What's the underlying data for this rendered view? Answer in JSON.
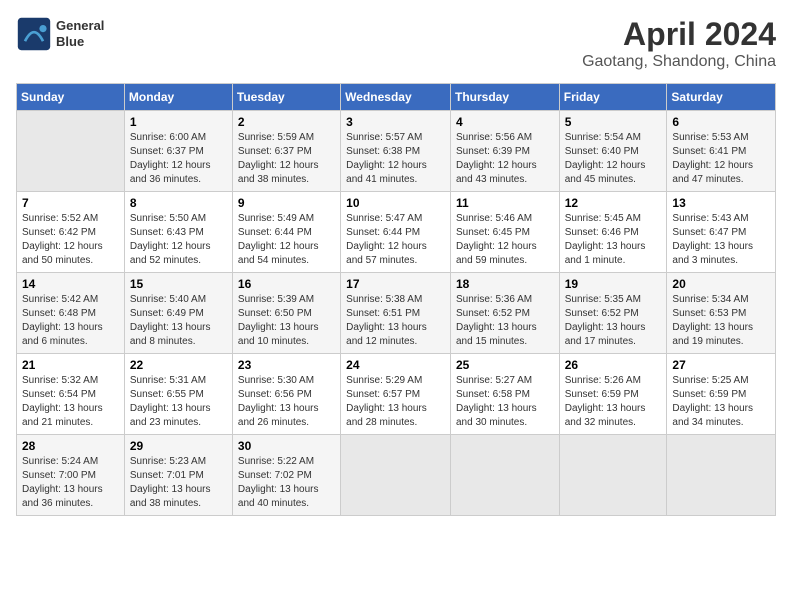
{
  "header": {
    "logo_line1": "General",
    "logo_line2": "Blue",
    "title": "April 2024",
    "subtitle": "Gaotang, Shandong, China"
  },
  "weekdays": [
    "Sunday",
    "Monday",
    "Tuesday",
    "Wednesday",
    "Thursday",
    "Friday",
    "Saturday"
  ],
  "weeks": [
    [
      {
        "day": "",
        "info": ""
      },
      {
        "day": "1",
        "info": "Sunrise: 6:00 AM\nSunset: 6:37 PM\nDaylight: 12 hours\nand 36 minutes."
      },
      {
        "day": "2",
        "info": "Sunrise: 5:59 AM\nSunset: 6:37 PM\nDaylight: 12 hours\nand 38 minutes."
      },
      {
        "day": "3",
        "info": "Sunrise: 5:57 AM\nSunset: 6:38 PM\nDaylight: 12 hours\nand 41 minutes."
      },
      {
        "day": "4",
        "info": "Sunrise: 5:56 AM\nSunset: 6:39 PM\nDaylight: 12 hours\nand 43 minutes."
      },
      {
        "day": "5",
        "info": "Sunrise: 5:54 AM\nSunset: 6:40 PM\nDaylight: 12 hours\nand 45 minutes."
      },
      {
        "day": "6",
        "info": "Sunrise: 5:53 AM\nSunset: 6:41 PM\nDaylight: 12 hours\nand 47 minutes."
      }
    ],
    [
      {
        "day": "7",
        "info": "Sunrise: 5:52 AM\nSunset: 6:42 PM\nDaylight: 12 hours\nand 50 minutes."
      },
      {
        "day": "8",
        "info": "Sunrise: 5:50 AM\nSunset: 6:43 PM\nDaylight: 12 hours\nand 52 minutes."
      },
      {
        "day": "9",
        "info": "Sunrise: 5:49 AM\nSunset: 6:44 PM\nDaylight: 12 hours\nand 54 minutes."
      },
      {
        "day": "10",
        "info": "Sunrise: 5:47 AM\nSunset: 6:44 PM\nDaylight: 12 hours\nand 57 minutes."
      },
      {
        "day": "11",
        "info": "Sunrise: 5:46 AM\nSunset: 6:45 PM\nDaylight: 12 hours\nand 59 minutes."
      },
      {
        "day": "12",
        "info": "Sunrise: 5:45 AM\nSunset: 6:46 PM\nDaylight: 13 hours\nand 1 minute."
      },
      {
        "day": "13",
        "info": "Sunrise: 5:43 AM\nSunset: 6:47 PM\nDaylight: 13 hours\nand 3 minutes."
      }
    ],
    [
      {
        "day": "14",
        "info": "Sunrise: 5:42 AM\nSunset: 6:48 PM\nDaylight: 13 hours\nand 6 minutes."
      },
      {
        "day": "15",
        "info": "Sunrise: 5:40 AM\nSunset: 6:49 PM\nDaylight: 13 hours\nand 8 minutes."
      },
      {
        "day": "16",
        "info": "Sunrise: 5:39 AM\nSunset: 6:50 PM\nDaylight: 13 hours\nand 10 minutes."
      },
      {
        "day": "17",
        "info": "Sunrise: 5:38 AM\nSunset: 6:51 PM\nDaylight: 13 hours\nand 12 minutes."
      },
      {
        "day": "18",
        "info": "Sunrise: 5:36 AM\nSunset: 6:52 PM\nDaylight: 13 hours\nand 15 minutes."
      },
      {
        "day": "19",
        "info": "Sunrise: 5:35 AM\nSunset: 6:52 PM\nDaylight: 13 hours\nand 17 minutes."
      },
      {
        "day": "20",
        "info": "Sunrise: 5:34 AM\nSunset: 6:53 PM\nDaylight: 13 hours\nand 19 minutes."
      }
    ],
    [
      {
        "day": "21",
        "info": "Sunrise: 5:32 AM\nSunset: 6:54 PM\nDaylight: 13 hours\nand 21 minutes."
      },
      {
        "day": "22",
        "info": "Sunrise: 5:31 AM\nSunset: 6:55 PM\nDaylight: 13 hours\nand 23 minutes."
      },
      {
        "day": "23",
        "info": "Sunrise: 5:30 AM\nSunset: 6:56 PM\nDaylight: 13 hours\nand 26 minutes."
      },
      {
        "day": "24",
        "info": "Sunrise: 5:29 AM\nSunset: 6:57 PM\nDaylight: 13 hours\nand 28 minutes."
      },
      {
        "day": "25",
        "info": "Sunrise: 5:27 AM\nSunset: 6:58 PM\nDaylight: 13 hours\nand 30 minutes."
      },
      {
        "day": "26",
        "info": "Sunrise: 5:26 AM\nSunset: 6:59 PM\nDaylight: 13 hours\nand 32 minutes."
      },
      {
        "day": "27",
        "info": "Sunrise: 5:25 AM\nSunset: 6:59 PM\nDaylight: 13 hours\nand 34 minutes."
      }
    ],
    [
      {
        "day": "28",
        "info": "Sunrise: 5:24 AM\nSunset: 7:00 PM\nDaylight: 13 hours\nand 36 minutes."
      },
      {
        "day": "29",
        "info": "Sunrise: 5:23 AM\nSunset: 7:01 PM\nDaylight: 13 hours\nand 38 minutes."
      },
      {
        "day": "30",
        "info": "Sunrise: 5:22 AM\nSunset: 7:02 PM\nDaylight: 13 hours\nand 40 minutes."
      },
      {
        "day": "",
        "info": ""
      },
      {
        "day": "",
        "info": ""
      },
      {
        "day": "",
        "info": ""
      },
      {
        "day": "",
        "info": ""
      }
    ]
  ]
}
